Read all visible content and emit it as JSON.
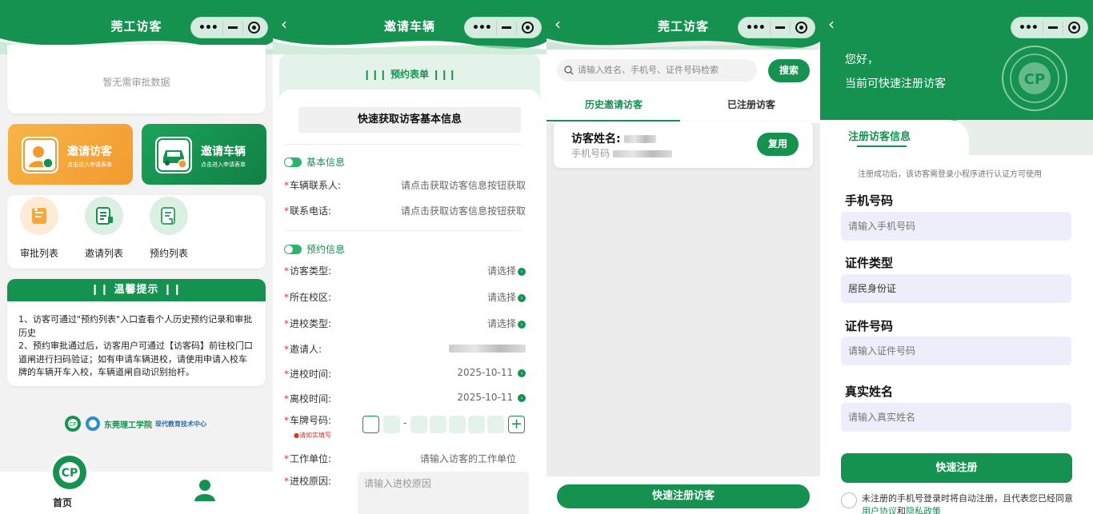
{
  "capsule": {
    "dots": "•••",
    "dash": "",
    "ring": ""
  },
  "screen1": {
    "title": "莞工访客",
    "empty_text": "暂无需审批数据",
    "invite_visitor": {
      "label": "邀请访客",
      "sub": "点击进入申请表单"
    },
    "invite_vehicle": {
      "label": "邀请车辆",
      "sub": "点击进入申请表单"
    },
    "nav": [
      {
        "label": "审批列表"
      },
      {
        "label": "邀请列表"
      },
      {
        "label": "预约列表"
      }
    ],
    "tips": {
      "title": "温馨提示",
      "lines": [
        "1、访客可通过\"预约列表\"入口查看个人历史预约记录和审批历史",
        "2、预约审批通过后，访客用户可通过【访客码】前往校门口道闸进行扫码验证；如有申请车辆进校，请使用申请入校车牌的车辆开车入校，车辆道闸自动识别抬杆。"
      ]
    },
    "footer_logo": {
      "school": "东莞理工学院",
      "center": "现代教育技术中心"
    },
    "tabbar": {
      "home": "首页"
    }
  },
  "screen2": {
    "title": "邀请车辆",
    "back": "‹",
    "form_title": "预约表单",
    "fetch_button": "快速获取访客基本信息",
    "basic_section": "基本信息",
    "appointment_section": "预约信息",
    "fields": {
      "contact": {
        "label": "车辆联系人:",
        "value": "请点击获取访客信息按钮获取"
      },
      "phone": {
        "label": "联系电话:",
        "value": "请点击获取访客信息按钮获取"
      },
      "visitor_type": {
        "label": "访客类型:",
        "value": "请选择"
      },
      "campus": {
        "label": "所在校区:",
        "value": "请选择"
      },
      "entry_type": {
        "label": "进校类型:",
        "value": "请选择"
      },
      "inviter": {
        "label": "邀请人:",
        "value": ""
      },
      "entry_time": {
        "label": "进校时间:",
        "value": "2025-10-11"
      },
      "leave_time": {
        "label": "离校时间:",
        "value": "2025-10-11"
      },
      "plate": {
        "label": "车牌号码:",
        "hint": "请如实填写",
        "separator": "-",
        "add": "+"
      },
      "work_unit": {
        "label": "工作单位:",
        "value": "请输入访客的工作单位"
      },
      "reason": {
        "label": "进校原因:",
        "placeholder": "请输入进校原因"
      }
    }
  },
  "screen3": {
    "title": "莞工访客",
    "back": "‹",
    "search_placeholder": "请输入姓名、手机号、证件号码检索",
    "search_button": "搜索",
    "tabs": [
      "历史邀请访客",
      "已注册访客"
    ],
    "visitor": {
      "name_label": "访客姓名:",
      "phone_label": "手机号码"
    },
    "reuse_button": "复用",
    "bottom_button": "快速注册访客"
  },
  "screen4": {
    "back": "‹",
    "greeting": [
      "您好，",
      "当前可快速注册访客"
    ],
    "tab_label": "注册访客信息",
    "notice": "注册成功后，该访客需登录小程序进行认证方可使用",
    "fields": [
      {
        "label": "手机号码",
        "placeholder": "请输入手机号码",
        "value": ""
      },
      {
        "label": "证件类型",
        "placeholder": "",
        "value": "居民身份证"
      },
      {
        "label": "证件号码",
        "placeholder": "请输入证件号码",
        "value": ""
      },
      {
        "label": "真实姓名",
        "placeholder": "请输入真实姓名",
        "value": ""
      }
    ],
    "register_button": "快速注册",
    "agreement_text": "未注册的手机号登录时将自动注册，且代表您已经同意",
    "agreement_link1": "用户协议",
    "agreement_and": "和",
    "agreement_link2": "隐私政策"
  },
  "colors": {
    "brand_green": "#159250",
    "invite_orange": "#f6a83c",
    "required_red": "#d9322e"
  }
}
